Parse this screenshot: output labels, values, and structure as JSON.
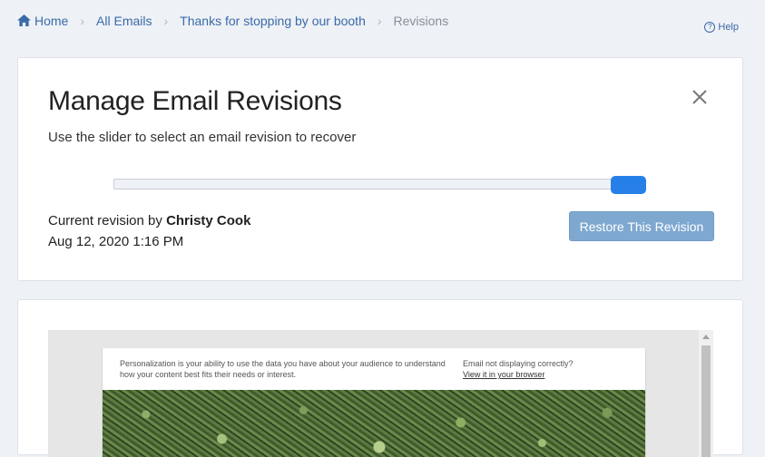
{
  "breadcrumb": {
    "items": [
      {
        "label": "Home",
        "icon": "home-icon"
      },
      {
        "label": "All Emails"
      },
      {
        "label": "Thanks for stopping by our booth"
      },
      {
        "label": "Revisions"
      }
    ]
  },
  "help": {
    "label": "Help",
    "icon": "question-circle-icon"
  },
  "modal": {
    "title": "Manage Email Revisions",
    "subtitle": "Use the slider to select an email revision to recover",
    "close_icon": "close-icon",
    "slider": {
      "position_fraction": 1.0
    },
    "current_revision_prefix": "Current revision by ",
    "author": "Christy Cook",
    "date": "Aug 12, 2020 1:16 PM",
    "restore_label": "Restore This Revision"
  },
  "preview": {
    "header_left": "Personalization is your ability to use the data you have about your audience to understand how your content best fits their needs or interest.",
    "header_right_line1": "Email not displaying correctly?",
    "header_right_link": "View it in your browser"
  },
  "colors": {
    "accent": "#2680e8",
    "button": "#7ea8d0",
    "link": "#3a6aa8",
    "background": "#eef1f6"
  }
}
